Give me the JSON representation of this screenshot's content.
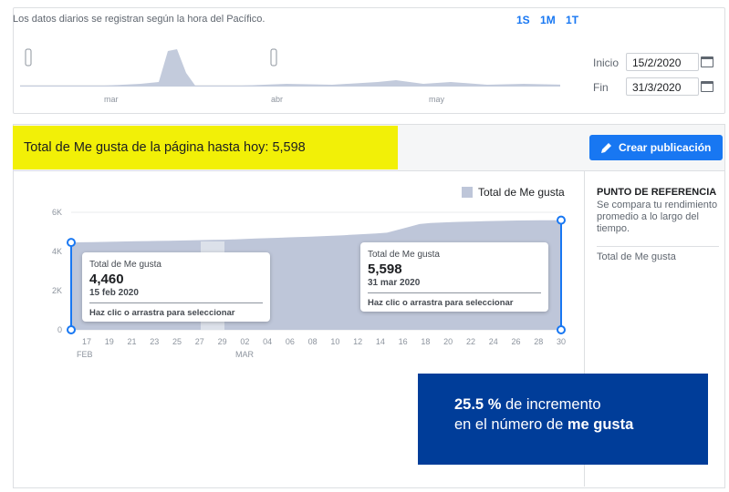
{
  "top": {
    "daily_note": "Los datos diarios se registran según la hora del Pacífico.",
    "range_buttons": [
      "1S",
      "1M",
      "1T"
    ],
    "mini_months": [
      "mar",
      "abr",
      "may"
    ],
    "start_label": "Inicio",
    "start_value": "15/2/2020",
    "end_label": "Fin",
    "end_value": "31/3/2020"
  },
  "header": {
    "title": "Total de Me gusta de la página hasta hoy: 5,598",
    "create_button": "Crear publicación"
  },
  "legend": {
    "series_name": "Total de Me gusta"
  },
  "sidebar": {
    "title": "PUNTO DE REFERENCIA",
    "description": "Se compara tu rendimiento promedio a lo largo del tiempo.",
    "metric": "Total de Me gusta"
  },
  "tooltip_left": {
    "label": "Total de Me gusta",
    "value": "4,460",
    "date": "15 feb 2020",
    "hint": "Haz clic o arrastra para seleccionar"
  },
  "tooltip_right": {
    "label": "Total de Me gusta",
    "value": "5,598",
    "date": "31 mar 2020",
    "hint": "Haz clic o arrastra para seleccionar"
  },
  "info_box": {
    "pct": "25.5 %",
    "line1_rest": " de incremento",
    "line2_prefix": "en el número de ",
    "line2_bold": "me gusta"
  },
  "colors": {
    "accent": "#1877f2",
    "highlight": "#f2f007",
    "area": "#bec6d9",
    "info_box": "#003d99"
  },
  "chart_data": {
    "type": "area",
    "title": "",
    "series": [
      {
        "name": "Total de Me gusta",
        "values": [
          4460,
          4470,
          4480,
          4490,
          4500,
          4510,
          4520,
          4530,
          4540,
          4550,
          4560,
          4570,
          4580,
          4590,
          4600,
          4620,
          4640,
          4660,
          4680,
          4700,
          4720,
          4740,
          4760,
          4780,
          4800,
          4830,
          4860,
          4890,
          4920,
          4960,
          5100,
          5250,
          5400,
          5450,
          5480,
          5500,
          5515,
          5530,
          5545,
          5560,
          5570,
          5580,
          5585,
          5590,
          5595,
          5598
        ]
      }
    ],
    "x_ticks": [
      "17",
      "19",
      "21",
      "23",
      "25",
      "27",
      "29",
      "02",
      "04",
      "06",
      "08",
      "10",
      "12",
      "14",
      "16",
      "18",
      "20",
      "22",
      "24",
      "26",
      "28",
      "30"
    ],
    "month_labels": [
      "FEB",
      "MAR"
    ],
    "y_ticks": [
      "0",
      "2K",
      "4K",
      "6K"
    ],
    "ylim": [
      0,
      6000
    ],
    "grid": true
  }
}
